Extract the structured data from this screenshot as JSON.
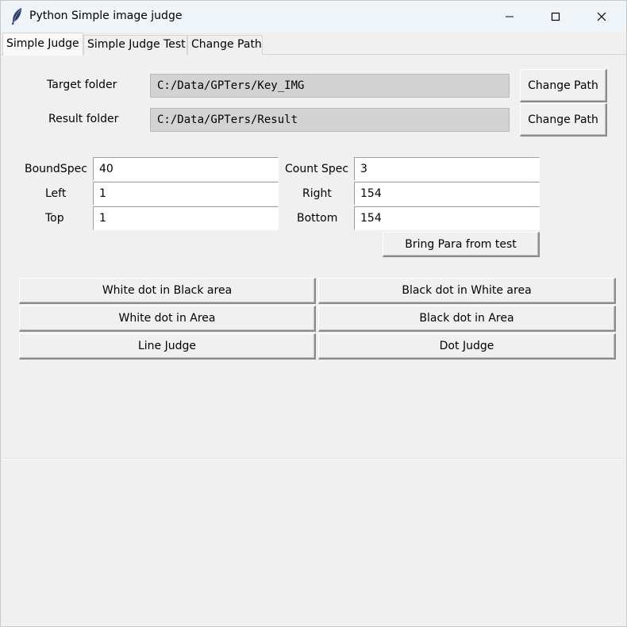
{
  "window": {
    "title": "Python Simple image judge",
    "icon": "feather-icon"
  },
  "tabs": [
    {
      "label": "Simple Judge",
      "active": true
    },
    {
      "label": "Simple Judge Test",
      "active": false
    },
    {
      "label": "Change Path",
      "active": false
    }
  ],
  "folders": {
    "target_label": "Target folder",
    "target_value": "C:/Data/GPTers/Key_IMG",
    "target_button": "Change Path",
    "result_label": "Result folder",
    "result_value": "C:/Data/GPTers/Result",
    "result_button": "Change Path"
  },
  "params": {
    "bound_spec_label": "BoundSpec",
    "bound_spec_value": "40",
    "count_spec_label": "Count Spec",
    "count_spec_value": "3",
    "left_label": "Left",
    "left_value": "1",
    "right_label": "Right",
    "right_value": "154",
    "top_label": "Top",
    "top_value": "1",
    "bottom_label": "Bottom",
    "bottom_value": "154",
    "bring_button": "Bring Para from test"
  },
  "judge_buttons": {
    "white_in_black": "White dot in Black area",
    "black_in_white": "Black dot in White area",
    "white_in_area": "White dot in Area",
    "black_in_area": "Black dot in Area",
    "line_judge": "Line Judge",
    "dot_judge": "Dot Judge"
  },
  "colors": {
    "window_bg": "#f0f0f0",
    "titlebar_bg": "#eff4f9",
    "path_field_bg": "#d3d3d3",
    "entry_bg": "#ffffff"
  }
}
